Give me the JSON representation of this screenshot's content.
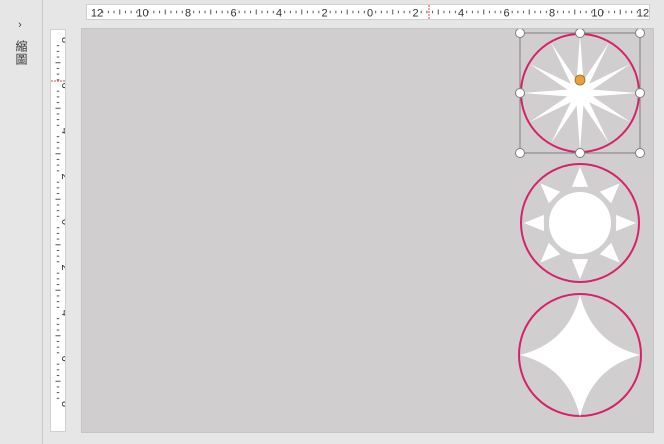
{
  "pane": {
    "label": "縮圖",
    "expand_glyph": "›"
  },
  "ruler": {
    "horizontal_labels": [
      "12",
      "10",
      "8",
      "6",
      "4",
      "2",
      "0",
      "2",
      "4",
      "6",
      "8",
      "10",
      "12"
    ],
    "vertical_labels": [
      "8",
      "6",
      "4",
      "2",
      "0",
      "2",
      "4",
      "6",
      "8"
    ]
  },
  "shapes": [
    {
      "name": "star-12-point-shape",
      "selected": true
    },
    {
      "name": "sun-shape",
      "selected": false
    },
    {
      "name": "star-4-point-shape",
      "selected": false
    }
  ],
  "colors": {
    "canvas": "#d0cece",
    "shape_outline": "#d6226a",
    "shape_fill": "#ffffff",
    "selection_border": "#7f7f7f",
    "rotation_handle": "#e3a33a"
  }
}
